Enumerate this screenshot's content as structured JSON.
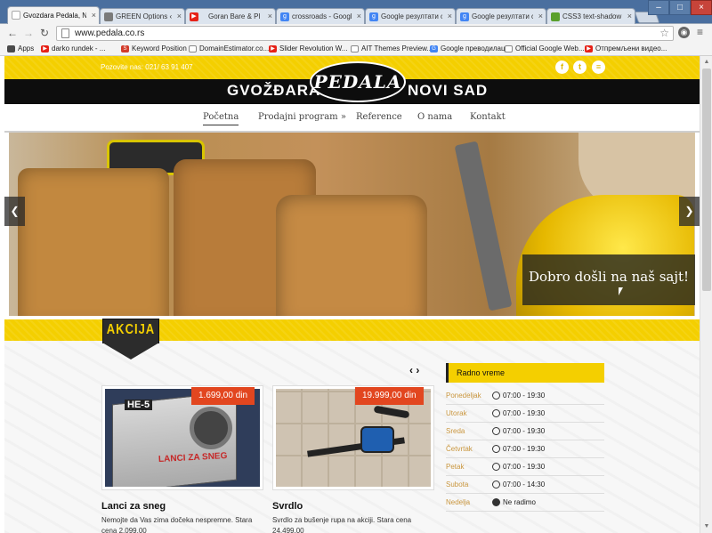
{
  "browser": {
    "tabs": [
      {
        "label": "Gvozdara Pedala, No",
        "icon_color": "#ffffff",
        "active": true
      },
      {
        "label": "GREEN Options ‹ Gri",
        "icon_color": "#7a7a7a",
        "active": false
      },
      {
        "label": "Goran Bare & Pl",
        "icon_color": "#e62117",
        "active": false
      },
      {
        "label": "crossroads - Google",
        "icon_color": "#4285f4",
        "active": false
      },
      {
        "label": "Google резултати ст",
        "icon_color": "#4285f4",
        "active": false
      },
      {
        "label": "Google резултати ст",
        "icon_color": "#4285f4",
        "active": false
      },
      {
        "label": "CSS3 text-shadow pr",
        "icon_color": "#5aa02c",
        "active": false
      }
    ],
    "tab_close": "×",
    "url": "www.pedala.co.rs",
    "bookmarks": [
      {
        "label": "Apps",
        "icon": "apps-icon",
        "color": "#4a4a4a"
      },
      {
        "label": "darko rundek - ...",
        "icon": "youtube-icon",
        "color": "#e62117"
      },
      {
        "label": "Keyword Position",
        "icon": "s-icon",
        "color": "#d23b2a"
      },
      {
        "label": "DomainEstimator.co...",
        "icon": "page-icon",
        "color": "#888888"
      },
      {
        "label": "Slider Revolution W...",
        "icon": "youtube-icon",
        "color": "#e62117"
      },
      {
        "label": "AIT Themes Preview...",
        "icon": "page-icon",
        "color": "#888888"
      },
      {
        "label": "Google преводилац",
        "icon": "translate-icon",
        "color": "#4285f4"
      },
      {
        "label": "Official Google Web...",
        "icon": "page-icon",
        "color": "#888888"
      },
      {
        "label": "Отпремљени видео...",
        "icon": "youtube-icon",
        "color": "#e62117"
      }
    ]
  },
  "site": {
    "phone": "Pozovite nas: 021/ 63 91 407",
    "brand_left": "GVOŽĐARA",
    "logo": "PEDALA",
    "brand_right": "NOVI SAD",
    "social": [
      "f",
      "t",
      "≡"
    ],
    "nav": [
      "Početna",
      "Prodajni program »",
      "Reference",
      "O nama",
      "Kontakt"
    ],
    "slider": {
      "caption": "Dobro došli na naš sajt!",
      "prev": "❮",
      "next": "❯"
    },
    "akcija": "AKCIJA",
    "carousel_arrows": "‹ ›",
    "products": [
      {
        "price": "1.699,00 din",
        "title": "Lanci za sneg",
        "desc": "Nemojte da Vas zima dočeka nespremne. Stara cena 2.099,00",
        "img_label": "LANCI ZA SNEG",
        "img_brand": "HE-5"
      },
      {
        "price": "19.999,00 din",
        "title": "Svrdlo",
        "desc": "Svrdlo za bušenje rupa na akciji. Stara cena 24.499,00"
      }
    ],
    "hours": {
      "title": "Radno vreme",
      "rows": [
        {
          "day": "Ponedeljak",
          "time": "07:00 - 19:30"
        },
        {
          "day": "Utorak",
          "time": "07:00 - 19:30"
        },
        {
          "day": "Sreda",
          "time": "07:00 - 19:30"
        },
        {
          "day": "Četvrtak",
          "time": "07:00 - 19:30"
        },
        {
          "day": "Petak",
          "time": "07:00 - 19:30"
        },
        {
          "day": "Subota",
          "time": "07:00 - 14:30"
        },
        {
          "day": "Nedelja",
          "time": "Ne radimo",
          "closed": true
        }
      ]
    }
  },
  "colors": {
    "accent_yellow": "#f4cf00",
    "price_red": "#e2461f",
    "day_orange": "#c9963e"
  }
}
